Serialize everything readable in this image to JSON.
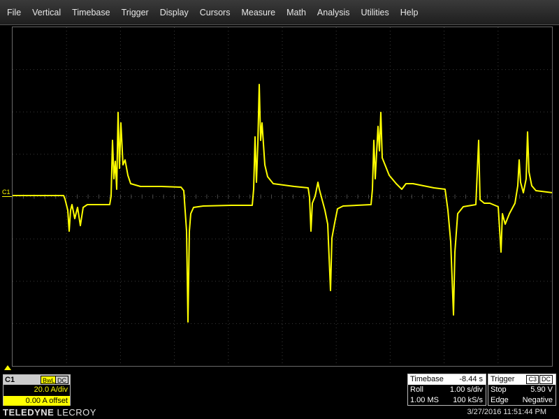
{
  "menu": [
    "File",
    "Vertical",
    "Timebase",
    "Trigger",
    "Display",
    "Cursors",
    "Measure",
    "Math",
    "Analysis",
    "Utilities",
    "Help"
  ],
  "channel": {
    "marker": "C1",
    "name": "C1",
    "bw_tag": "BwL",
    "coupling": "DC",
    "scale": "20.0 A/div",
    "offset": "0.00 A offset",
    "color": "#ffff00"
  },
  "timebase": {
    "label": "Timebase",
    "delay": "-8.44 s",
    "mode": "Roll",
    "per_div": "1.00 s/div",
    "points": "1.00 MS",
    "rate": "100 kS/s"
  },
  "trigger": {
    "label": "Trigger",
    "source": "C3",
    "coupling": "DC",
    "state": "Stop",
    "level": "5.90 V",
    "type": "Edge",
    "slope": "Negative"
  },
  "brand": {
    "part1": "TELEDYNE",
    "part2": "LECROY"
  },
  "timestamp": "3/27/2016 11:51:44 PM"
}
